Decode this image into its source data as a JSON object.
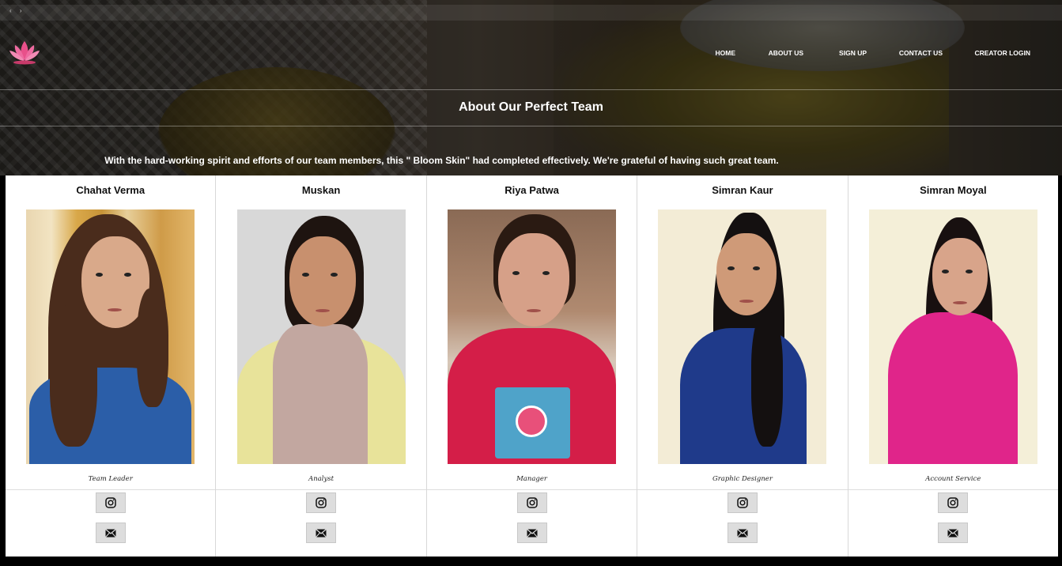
{
  "window": {
    "controls": "‹ ›"
  },
  "nav": {
    "items": [
      {
        "label": "HOME"
      },
      {
        "label": "ABOUT US"
      },
      {
        "label": "SIGN UP"
      },
      {
        "label": "CONTACT US"
      },
      {
        "label": "CREATOR LOGIN"
      }
    ]
  },
  "hero": {
    "title": "About Our Perfect Team",
    "subtitle": "With the hard-working spirit and efforts of our team members, this \" Bloom Skin\" had completed effectively. We're grateful of having such great team."
  },
  "team": [
    {
      "name": "Chahat Verma",
      "role": "Team Leader",
      "top": "#2b5ea8",
      "skin": "#d9a98a",
      "hair": "#4a2c1c",
      "bg": "#d9b26a"
    },
    {
      "name": "Muskan",
      "role": "Analyst",
      "top": "#e8e39a",
      "skin": "#c8906e",
      "hair": "#1e1410",
      "bg": "#d9d9d9"
    },
    {
      "name": "Riya Patwa",
      "role": "Manager",
      "top": "#d41e48",
      "skin": "#d6a088",
      "hair": "#2a1a12",
      "bg": "#8a6a55"
    },
    {
      "name": "Simran Kaur",
      "role": "Graphic Designer",
      "top": "#1f3a8a",
      "skin": "#cf9a78",
      "hair": "#141010",
      "bg": "#f3ecd6"
    },
    {
      "name": "Simran Moyal",
      "role": "Account Service",
      "top": "#e0258a",
      "skin": "#d8a48a",
      "hair": "#181010",
      "bg": "#f4efd8"
    }
  ],
  "icons": {
    "instagram": "instagram-icon",
    "mail": "mail-icon"
  },
  "colors": {
    "accent_logo": "#e8508a",
    "card_border": "#d8d8d8",
    "icon_button": "#dddddd"
  }
}
